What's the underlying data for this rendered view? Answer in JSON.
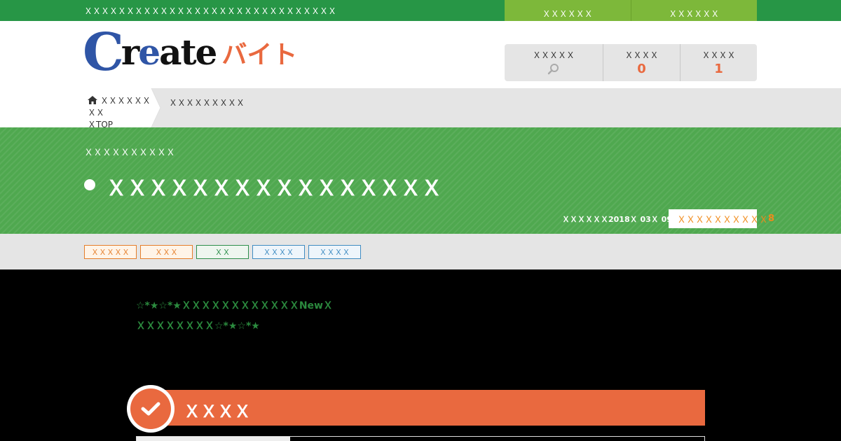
{
  "topbar": {
    "tagline": "ＸＸＸＸＸＸＸＸＸＸＸＸＸＸＸＸＸＸＸＸＸＸＸＸＸＸＸＸＸＸ",
    "links": [
      "ＸＸＸＸＸＸ",
      "ＸＸＸＸＸＸ"
    ]
  },
  "logo": {
    "c": "C",
    "r": "r",
    "e": "e",
    "ate": "ate",
    "sub": "バイト"
  },
  "stats": {
    "search_label": "ＸＸＸＸＸ",
    "a_label": "ＸＸＸＸ",
    "a_value": "0",
    "b_label": "ＸＸＸＸ",
    "b_value": "1"
  },
  "breadcrumb": {
    "home_line1": "ＸＸＸＸＸＸＸＸ",
    "home_line2": "ＸTOP",
    "current": "ＸＸＸＸＸＸＸＸＸ"
  },
  "banner": {
    "kicker": "ＸＸＸＸＸＸＸＸＸＸ",
    "title": "ＸＸＸＸＸＸＸＸＸＸＸＸＸＸＸＸ",
    "date": "ＸＸＸＸＸＸ2018Ｘ 03Ｘ 09Ｘ",
    "deadline_label": "ＸＸＸＸＸＸＸＸＸＸ",
    "deadline_num": "8"
  },
  "tags": [
    {
      "label": "ＸＸＸＸＸ",
      "color": "orange"
    },
    {
      "label": "ＸＸＸ",
      "color": "orange"
    },
    {
      "label": "ＸＸ",
      "color": "green"
    },
    {
      "label": "ＸＸＸＸ",
      "color": "blue"
    },
    {
      "label": "ＸＸＸＸ",
      "color": "blue"
    }
  ],
  "intro": {
    "line1": "☆*★☆*★ＸＸＸＸＸＸＸＸＸＸＸＸNewＸ",
    "line2": "ＸＸＸＸＸＸＸＸ☆*★☆*★"
  },
  "section": {
    "title": "ＸＸＸＸ"
  },
  "colors": {
    "primary_green": "#279646",
    "banner_green": "#4fa84f",
    "lime": "#7db83a",
    "accent_orange": "#e9693f",
    "logo_blue": "#2f55a6"
  }
}
